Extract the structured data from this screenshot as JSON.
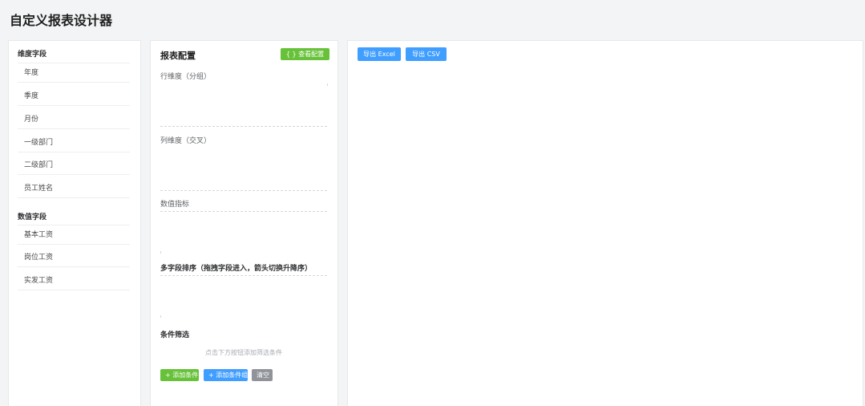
{
  "app": {
    "title": "自定义报表设计器"
  },
  "fields": {
    "dimension_title": "维度字段",
    "dimension_items": [
      "年度",
      "季度",
      "月份",
      "一级部门",
      "二级部门",
      "员工姓名"
    ],
    "metric_title": "数值字段",
    "metric_items": [
      "基本工资",
      "岗位工资",
      "实发工资"
    ]
  },
  "config": {
    "title": "报表配置",
    "view_config_label": "{ } 查看配置",
    "row_dim_label": "行维度（分组）",
    "col_dim_label": "列维度（交叉）",
    "metrics_label": "数值指标",
    "sort_label": "多字段排序（拖拽字段进入，箭头切换升降序）",
    "filter_label": "条件筛选",
    "filter_empty_hint": "点击下方按钮添加筛选条件",
    "add_condition_label": "+ 添加条件",
    "add_condition_group_label": "+ 添加条件组",
    "clear_label": "清空"
  },
  "export": {
    "excel_label": "导出 Excel",
    "csv_label": "导出 CSV"
  },
  "colors": {
    "green": "#67c23a",
    "blue": "#409eff",
    "gray": "#909399"
  }
}
